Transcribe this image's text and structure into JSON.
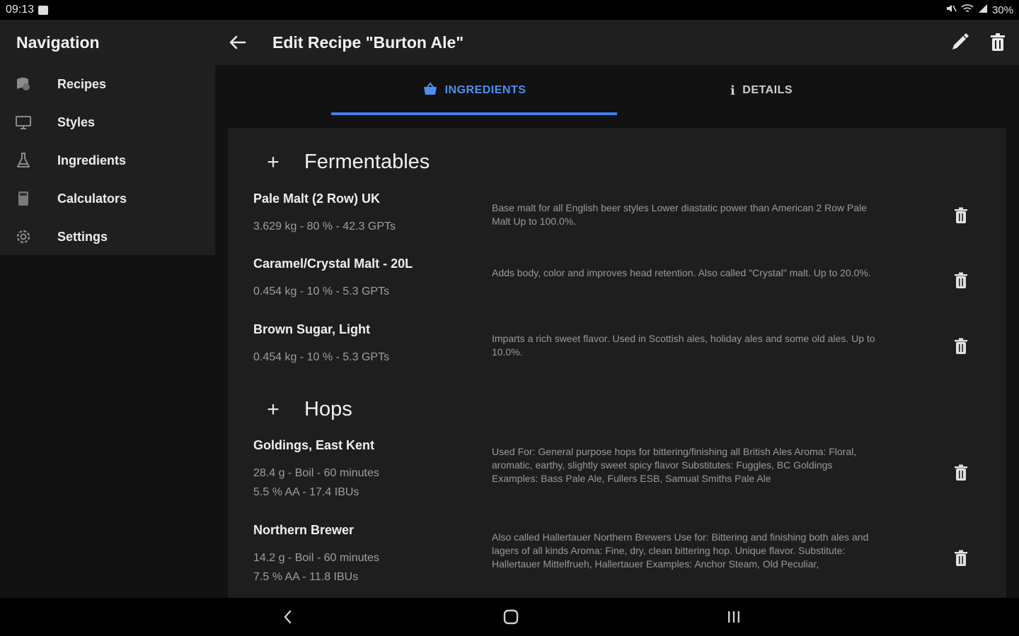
{
  "status_bar": {
    "time": "09:13",
    "battery": "30%"
  },
  "app_bar": {
    "nav_title": "Navigation",
    "page_title": "Edit Recipe \"Burton Ale\""
  },
  "sidebar": {
    "items": [
      {
        "label": "Recipes",
        "icon": "recipes-icon"
      },
      {
        "label": "Styles",
        "icon": "styles-icon"
      },
      {
        "label": "Ingredients",
        "icon": "flask-icon"
      },
      {
        "label": "Calculators",
        "icon": "calculator-icon"
      },
      {
        "label": "Settings",
        "icon": "gear-icon"
      }
    ]
  },
  "tabs": {
    "ingredients": "INGREDIENTS",
    "details": "DETAILS",
    "active": "ingredients"
  },
  "colors": {
    "accent": "#3f7fe8",
    "background": "#121212",
    "surface": "#1e1e1e"
  },
  "fermentables": {
    "title": "Fermentables",
    "items": [
      {
        "name": "Pale Malt (2 Row) UK",
        "meta": "3.629 kg - 80 % - 42.3 GPTs",
        "description": "Base malt for all English beer styles Lower diastatic power than American 2 Row Pale Malt Up to 100.0%."
      },
      {
        "name": "Caramel/Crystal Malt - 20L",
        "meta": "0.454 kg - 10 % - 5.3 GPTs",
        "description": "Adds body, color and improves head retention. Also called \"Crystal\" malt. Up to 20.0%."
      },
      {
        "name": "Brown Sugar, Light",
        "meta": "0.454 kg - 10 % - 5.3 GPTs",
        "description": "Imparts a rich sweet flavor. Used in Scottish ales, holiday ales and some old ales. Up to 10.0%."
      }
    ]
  },
  "hops": {
    "title": "Hops",
    "items": [
      {
        "name": "Goldings, East Kent",
        "meta1": "28.4 g - Boil - 60 minutes",
        "meta2": "5.5 % AA - 17.4 IBUs",
        "description": "Used For: General purpose hops for bittering/finishing all British Ales Aroma: Floral, aromatic, earthy, slightly sweet spicy flavor Substitutes: Fuggles, BC Goldings Examples: Bass Pale Ale, Fullers ESB, Samual Smiths Pale Ale"
      },
      {
        "name": "Northern Brewer",
        "meta1": "14.2 g - Boil - 60 minutes",
        "meta2": "7.5 % AA - 11.8 IBUs",
        "description": "Also called Hallertauer Northern Brewers Use for: Bittering and finishing both ales and lagers of all kinds Aroma: Fine, dry, clean bittering hop. Unique flavor. Substitute: Hallertauer Mittelfrueh, Hallertauer Examples: Anchor Steam, Old Peculiar,"
      }
    ]
  }
}
